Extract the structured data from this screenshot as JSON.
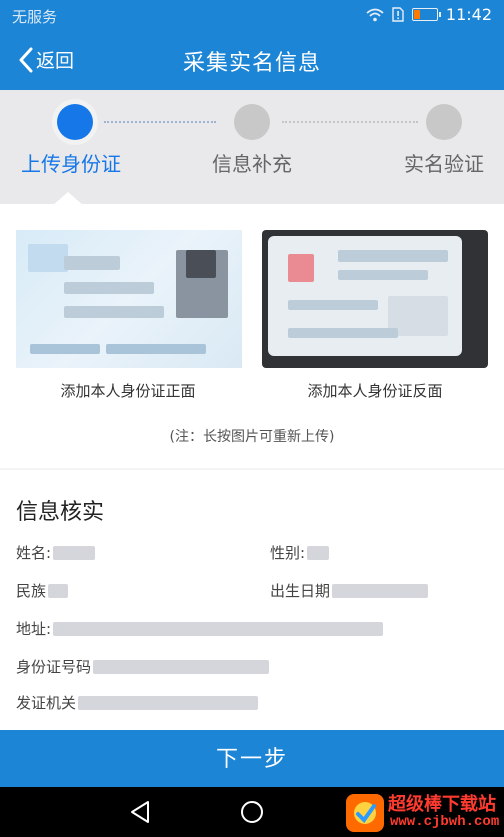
{
  "status_bar": {
    "carrier": "无服务",
    "time": "11:42"
  },
  "header": {
    "back_label": "返回",
    "title": "采集实名信息"
  },
  "steps": [
    {
      "label": "上传身份证",
      "active": true
    },
    {
      "label": "信息补充",
      "active": false
    },
    {
      "label": "实名验证",
      "active": false
    }
  ],
  "id_upload": {
    "front_label": "添加本人身份证正面",
    "back_label": "添加本人身份证反面",
    "note": "(注：长按图片可重新上传)"
  },
  "info": {
    "heading": "信息核实",
    "name_label": "姓名:",
    "gender_label": "性别:",
    "ethnicity_label": "民族",
    "birth_label": "出生日期",
    "address_label": "地址:",
    "id_number_label": "身份证号码",
    "authority_label": "发证机关"
  },
  "next_button": "下一步",
  "watermark": {
    "title": "超级棒下载站",
    "url": "www.cjbwh.com"
  },
  "colors": {
    "primary": "#1c85d6",
    "step_active": "#1677e8",
    "step_inactive": "#c8c8c8"
  }
}
